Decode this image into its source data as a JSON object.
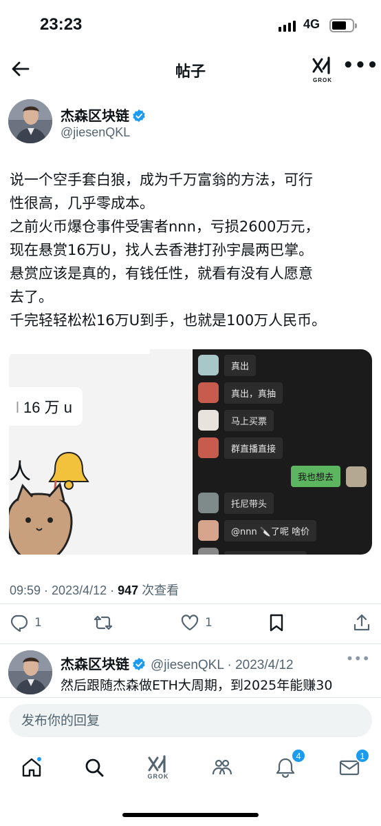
{
  "status_bar": {
    "time": "23:23",
    "network": "4G"
  },
  "header": {
    "title": "帖子",
    "grok_label": "GROK",
    "more": "•••"
  },
  "post": {
    "author_name": "杰森区块链",
    "handle": "@jiesenQKL",
    "lines": [
      "说一个空手套白狼，成为千万富翁的方法，可行",
      "性很高，几乎零成本。",
      "之前火币爆仓事件受害者nnn，亏损2600万元，",
      "现在悬赏16万U，找人去香港打孙宇晨两巴掌。",
      "悬赏应该是真的，有钱任性，就看有没有人愿意",
      "去了。",
      "千完轻轻松松16万U到手，也就是100万人民币。"
    ],
    "media": {
      "left_bubble": "16 万 u",
      "left_text": "人",
      "chat": [
        {
          "text": "真出"
        },
        {
          "text": "真出，真抽"
        },
        {
          "text": "马上买票"
        },
        {
          "text": "群直播直接"
        },
        {
          "text": "托尼带头"
        },
        {
          "text": "@nnn 🔪了呢 啥价"
        }
      ],
      "chat_me": "我也想去"
    },
    "time": "09:59",
    "date": "2023/4/12",
    "views": "947",
    "views_label": "次查看",
    "replies": "1",
    "likes": "1"
  },
  "reply": {
    "author_name": "杰森区块链",
    "handle_date": "@jiesenQKL · 2023/4/12",
    "text": "然后跟随杰森做ETH大周期，到2025年能赚30",
    "more": "•••"
  },
  "compose": {
    "placeholder": "发布你的回复"
  },
  "tabbar": {
    "grok_label": "GROK",
    "notifications_badge": "4",
    "messages_badge": "1"
  },
  "colors": {
    "accent": "#1d9bf0",
    "text": "#0f1419",
    "secondary": "#536471"
  }
}
